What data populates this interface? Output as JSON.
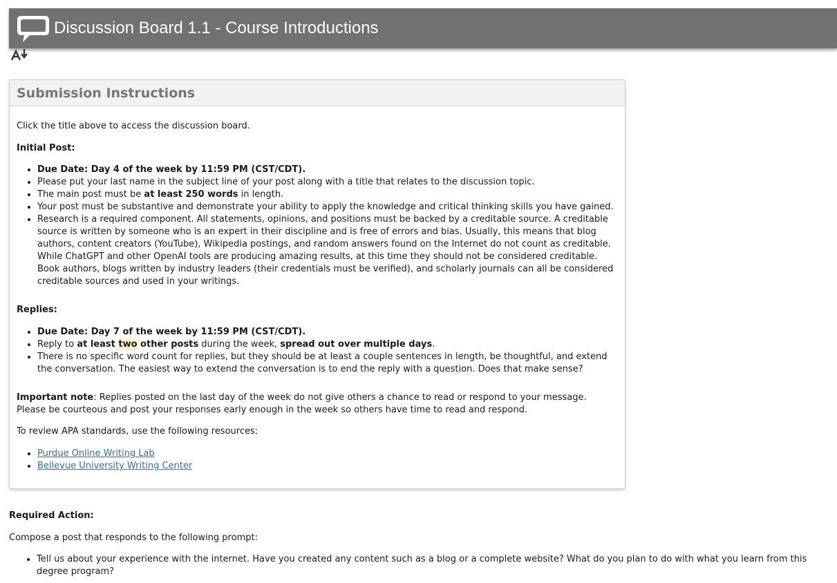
{
  "header": {
    "title": "Discussion Board 1.1 - Course Introductions"
  },
  "panel": {
    "title": "Submission Instructions",
    "intro": "Click the title above to access the discussion board.",
    "initial_heading": "Initial Post:",
    "initial_items": {
      "due": "Due Date: Day 4 of the week by 11:59 PM (CST/CDT).",
      "lastname": "Please put your last name in the subject line of your post along with a title that relates to the discussion topic.",
      "length_pre": "The main post must be ",
      "length_bold": "at least 250 words",
      "length_post": " in length.",
      "substantive": "Your post must be substantive and demonstrate your ability to apply the knowledge and critical thinking skills you have gained.",
      "research": "Research is a required component.  All statements, opinions, and positions must be backed by a creditable source.  A creditable source is written by someone who is an expert in their discipline and is free of errors and bias.  Usually, this means that blog authors, content creators (YouTube), Wikipedia postings, and random answers found on the Internet do not count as creditable.  While ChatGPT and other OpenAI tools are producing amazing results, at this time they should not be considered creditable.  Book authors, blogs written by industry leaders (their credentials must be verified), and scholarly journals can all be considered creditable sources and used in your writings."
    },
    "replies_heading": "Replies:",
    "reply_items": {
      "due": "Due Date: Day 7 of the week by 11:59 PM (CST/CDT).",
      "reply_pre": "Reply to ",
      "reply_b1": "at least ",
      "reply_hl": "two",
      "reply_b2": " other posts",
      "reply_mid": " during the week, ",
      "reply_b3": "spread out over multiple days",
      "reply_end": ".",
      "wordcount": "There is no specific word count for replies, but they should be at least a couple sentences in length, be thoughtful, and extend the conversation.  The easiest way to extend the conversation is to end the reply with a question.  Does that make sense?"
    },
    "note_label": "Important note",
    "note_text": ": Replies posted on the last day of the week do not give others a chance to read or respond to your message.  Please be courteous and post your responses early enough in the week so others have time to read and respond.",
    "apa_text": "To review APA standards, use the following resources:",
    "links": [
      "Purdue Online Writing Lab",
      "Bellevue University Writing Center"
    ]
  },
  "required": {
    "heading": "Required Action:",
    "compose": "Compose a post that responds to the following prompt:",
    "prompt": "Tell us about your experience with the internet.  Have you created any content such as a blog or a complete website?  What do you plan to do with what you learn from this degree program?"
  }
}
